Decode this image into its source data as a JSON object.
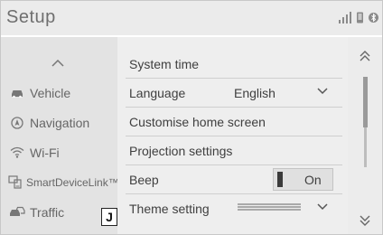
{
  "header": {
    "title": "Setup"
  },
  "sidebar": {
    "items": [
      {
        "label": "Vehicle",
        "icon": "car-icon"
      },
      {
        "label": "Navigation",
        "icon": "navigation-icon"
      },
      {
        "label": "Wi-Fi",
        "icon": "wifi-icon"
      },
      {
        "label": "SmartDeviceLink™",
        "icon": "smartdevicelink-icon"
      },
      {
        "label": "Traffic",
        "icon": "traffic-icon"
      }
    ]
  },
  "settings": {
    "system_time": "System time",
    "language": {
      "label": "Language",
      "value": "English"
    },
    "customise_home": "Customise home screen",
    "projection": "Projection settings",
    "beep": {
      "label": "Beep",
      "state": "On"
    },
    "theme": "Theme setting"
  },
  "callout": {
    "letter": "J"
  },
  "colors": {
    "text": "#3f3f3f",
    "background": "#eeeeee",
    "toggle_bar": "#3a3a3a"
  }
}
